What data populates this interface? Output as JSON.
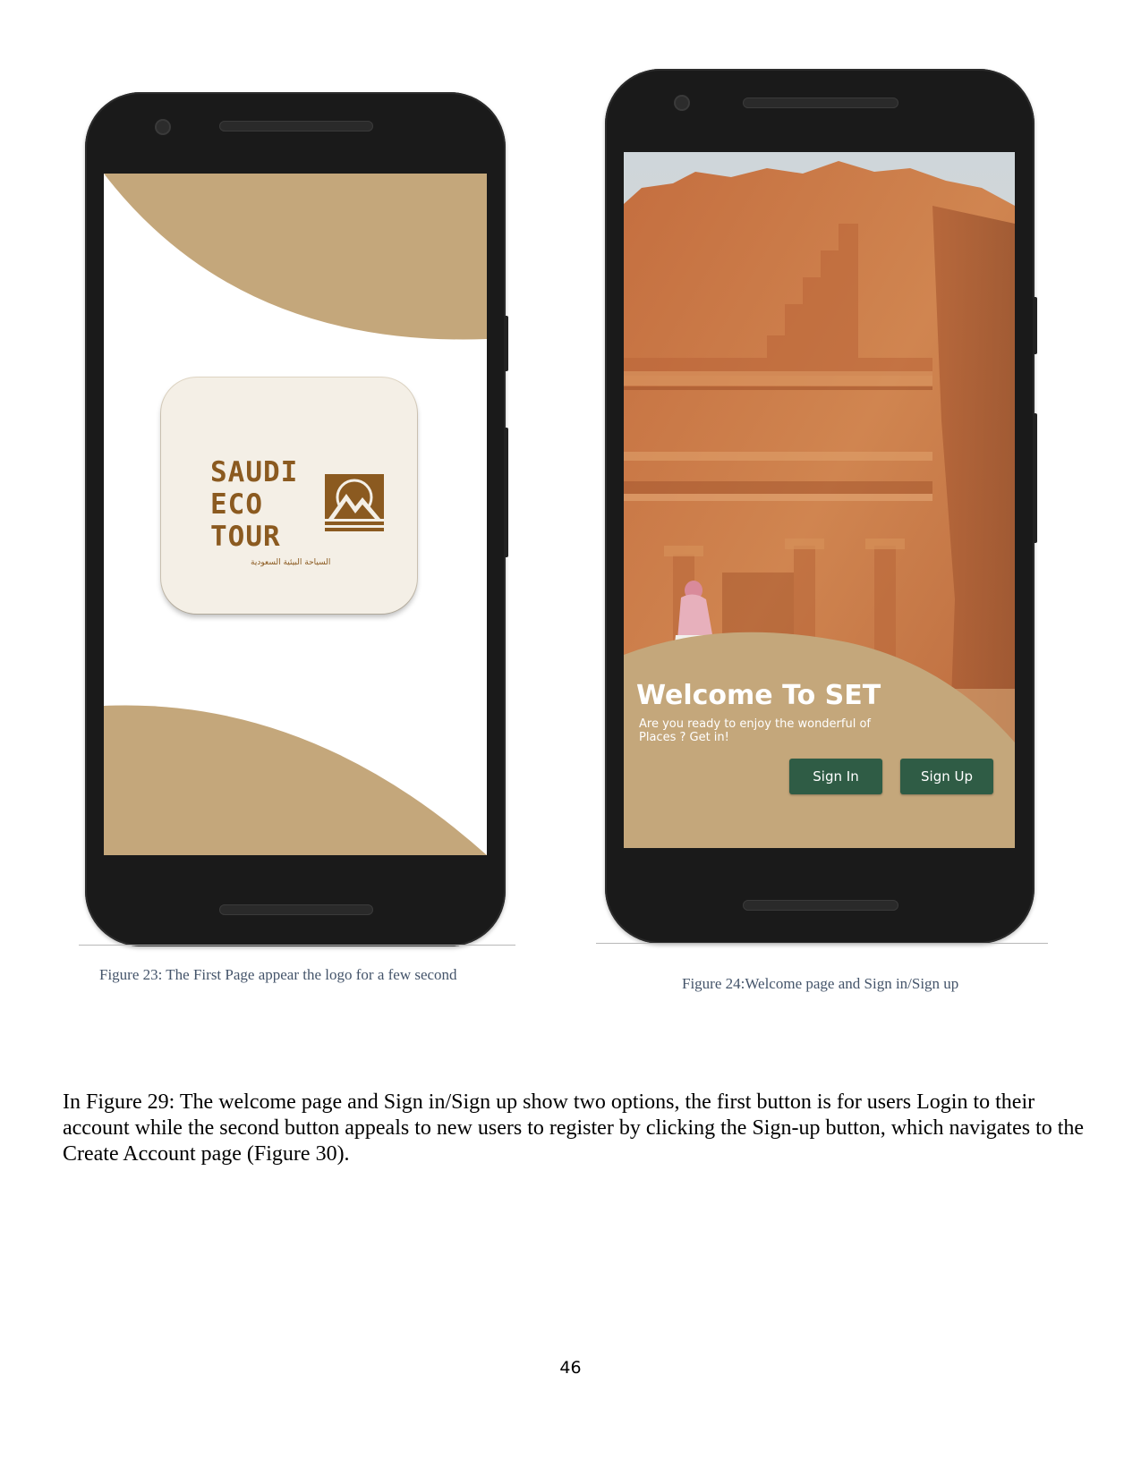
{
  "phone_left": {
    "logo": {
      "line1": "SAUDI",
      "line2": "ECO",
      "line3": "TOUR",
      "arabic_tagline": "السياحة البيئية السعودية",
      "emblem": "mountain-sun-icon",
      "brand_color": "#8b5a20"
    },
    "shape_color": "#c4a77b"
  },
  "phone_right": {
    "welcome_title": "Welcome To SET",
    "welcome_subtitle": "Are you ready to enjoy the wonderful of Places ? Get in!",
    "sign_in_label": "Sign In",
    "sign_up_label": "Sign Up",
    "button_color": "#2f5c45",
    "panel_color": "#c4a77b"
  },
  "captions": {
    "figure23": "Figure 23: The First Page appear the logo for a few second",
    "figure24": "Figure 24:Welcome page and Sign in/Sign up"
  },
  "body": {
    "paragraph": "In Figure 29: The welcome page and Sign in/Sign up show two options, the first button is for users Login to their account while the second button appeals to new users to register by clicking the Sign-up button, which navigates to the Create Account page (Figure 30)."
  },
  "page_number": "46"
}
